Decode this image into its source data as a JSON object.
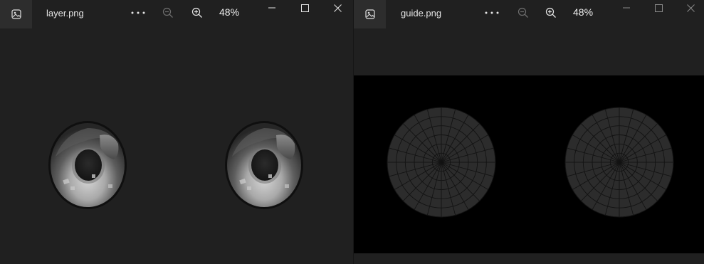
{
  "colors": {
    "window_bg": "#202020",
    "titlebar_icon_bg": "#2d2d2d",
    "text": "#e6e6e6",
    "guide_canvas_bg": "#000000",
    "guide_mesh_fill": "#2c2c2c",
    "guide_mesh_line": "#131313"
  },
  "left_window": {
    "filename": "layer.png",
    "zoom": "48%",
    "icons": [
      "photos-app-icon",
      "more-options-icon",
      "zoom-out-icon",
      "zoom-in-icon",
      "minimize-icon",
      "maximize-icon",
      "close-icon"
    ]
  },
  "right_window": {
    "filename": "guide.png",
    "zoom": "48%",
    "icons": [
      "photos-app-icon",
      "more-options-icon",
      "zoom-out-icon",
      "zoom-in-icon",
      "minimize-icon",
      "maximize-icon",
      "close-icon"
    ]
  },
  "guide_mesh": {
    "radial_divisions": 24,
    "rings": 6
  }
}
